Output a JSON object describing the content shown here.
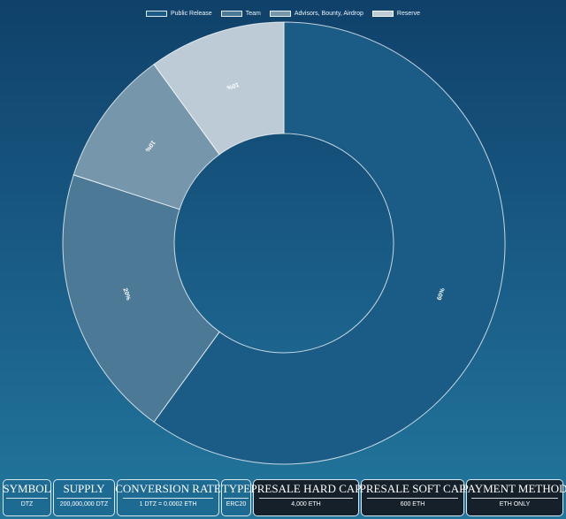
{
  "chart_data": {
    "type": "pie",
    "variant": "doughnut",
    "categories": [
      "Public Release",
      "Team",
      "Advisors, Bounty, Airdrop",
      "Reserve"
    ],
    "values": [
      60,
      20,
      10,
      10
    ],
    "value_labels": [
      "60%",
      "20%",
      "10%",
      "10%"
    ],
    "colors": [
      "#1b5c86",
      "#4b7996",
      "#7596ab",
      "#bccbd6"
    ],
    "legend_position": "top",
    "start": "top",
    "direction": "clockwise"
  },
  "info_bar": [
    {
      "title": "SYMBOL",
      "value": "DTZ",
      "theme": "light"
    },
    {
      "title": "SUPPLY",
      "value": "200,000,000 DTZ",
      "theme": "light"
    },
    {
      "title": "CONVERSION RATE",
      "value": "1 DTZ = 0.0002 ETH",
      "theme": "light"
    },
    {
      "title": "TYPE",
      "value": "ERC20",
      "theme": "light"
    },
    {
      "title": "PRESALE HARD CAP",
      "value": "4,000 ETH",
      "theme": "dark"
    },
    {
      "title": "PRESALE SOFT CAP",
      "value": "600 ETH",
      "theme": "dark"
    },
    {
      "title": "PAYMENT METHOD",
      "value": "ETH ONLY",
      "theme": "dark"
    }
  ]
}
